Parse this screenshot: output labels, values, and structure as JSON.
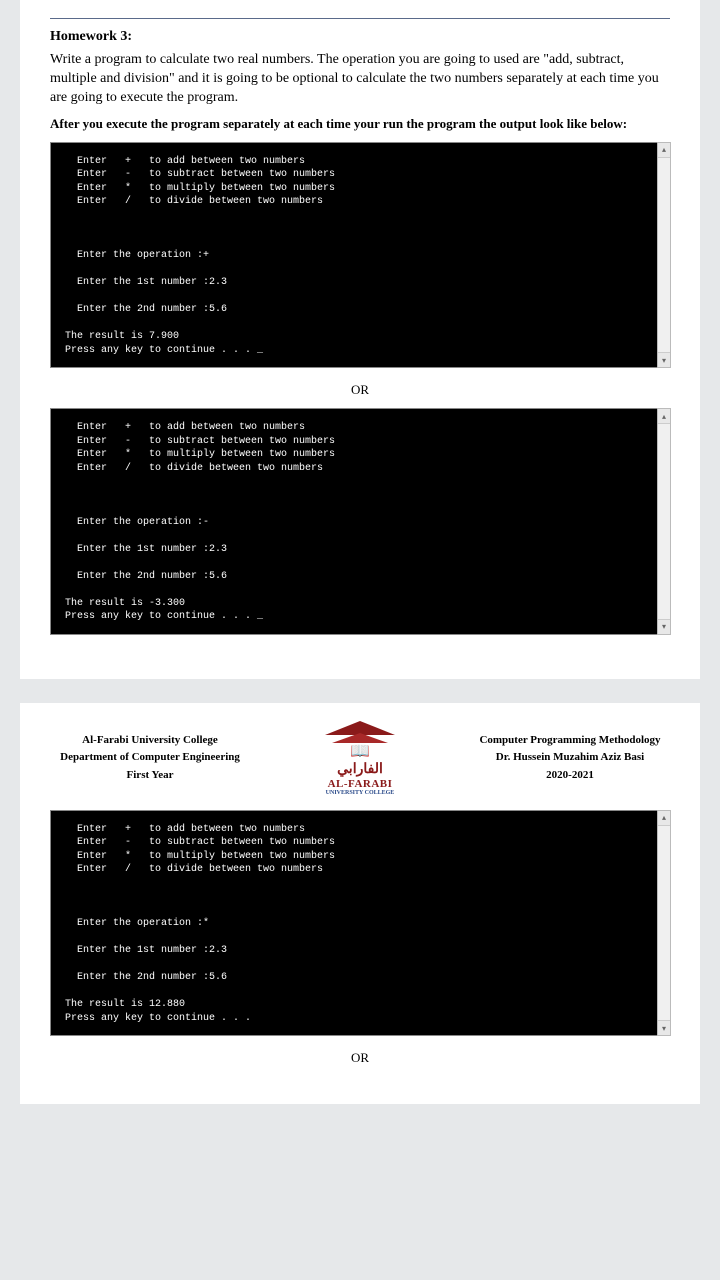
{
  "hw_title": "Homework 3:",
  "hw_desc": "Write a program to calculate two real numbers. The operation you are going to used are \"add, subtract, multiple and division\" and it is going to be optional to calculate the two numbers separately at each time you are going to execute the program.",
  "hw_note": "After you execute the program separately at each time your run the program the output look like below:",
  "or_label": "OR",
  "console_menu": "  Enter   +   to add between two numbers\n  Enter   -   to subtract between two numbers\n  Enter   *   to multiply between two numbers\n  Enter   /   to divide between two numbers",
  "console1": {
    "op": "Enter the operation :+",
    "n1": "Enter the 1st number :2.3",
    "n2": "Enter the 2nd number :5.6",
    "res": "The result is 7.900",
    "press": "Press any key to continue . . . _"
  },
  "console2": {
    "op": "Enter the operation :-",
    "n1": "Enter the 1st number :2.3",
    "n2": "Enter the 2nd number :5.6",
    "res": "The result is -3.300",
    "press": "Press any key to continue . . . _"
  },
  "console3": {
    "op": "Enter the operation :*",
    "n1": "Enter the 1st number :2.3",
    "n2": "Enter the 2nd number :5.6",
    "res": "The result is 12.880",
    "press": "Press any key to continue . . ."
  },
  "header": {
    "left1": "Al-Farabi University College",
    "left2": "Department of Computer Engineering",
    "left3": "First Year",
    "right1": "Computer Programming Methodology",
    "right2": "Dr. Hussein Muzahim Aziz Basi",
    "right3": "2020-2021",
    "arabic": "الفارابي",
    "logo_name": "AL-FARABI",
    "logo_sub": "UNIVERSITY COLLEGE"
  }
}
